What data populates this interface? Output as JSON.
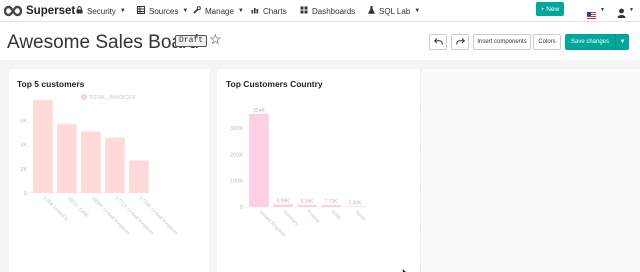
{
  "navbar": {
    "brand": "Superset",
    "menu": [
      {
        "label": "Security",
        "icon": "lock-icon"
      },
      {
        "label": "Sources",
        "icon": "database-icon"
      },
      {
        "label": "Manage",
        "icon": "wrench-icon"
      },
      {
        "label": "Charts",
        "icon": "bar-chart-icon"
      },
      {
        "label": "Dashboards",
        "icon": "dashboard-icon"
      },
      {
        "label": "SQL Lab",
        "icon": "flask-icon"
      }
    ],
    "new_button": "+ New",
    "language_icon": "us-flag-icon",
    "user_icon": "user-icon"
  },
  "header": {
    "title": "Awesome Sales Board",
    "badge": "Draft",
    "favorite_icon": "star-outline-icon",
    "undo_icon": "undo-icon",
    "redo_icon": "redo-icon",
    "insert_components": "Insert components",
    "colors": "Colors",
    "save_changes": "Save changes"
  },
  "colors": {
    "accent": "#00a699",
    "bar_chart1": "#ffdada",
    "bar_chart2": "#ffd0e4"
  },
  "chart_data": [
    {
      "type": "bar",
      "title": "Top 5 customers",
      "legend": [
        "TOTAL_INVOICES"
      ],
      "legend_position": "top",
      "categories": [
        "1784: United K...",
        "18511: EIRE",
        "18086: United Kingdom",
        "17713: United Kingdom",
        "17746: United Kingdom"
      ],
      "values": [
        7700,
        5700,
        5100,
        4600,
        2700
      ],
      "yticks": [
        "0",
        "2K",
        "4K",
        "6K"
      ],
      "ylim": [
        0,
        8200
      ]
    },
    {
      "type": "bar",
      "title": "Top Customers Country",
      "categories": [
        "United Kingdom",
        "Germany",
        "France",
        "EIRE",
        "Spain"
      ],
      "values": [
        354000,
        9990,
        8340,
        7720,
        2450
      ],
      "data_labels": [
        "354K",
        "9.99K",
        "8.34K",
        "7.72K",
        "2.45K"
      ],
      "yticks": [
        "0",
        "100K",
        "200K",
        "300K"
      ],
      "ylim": [
        0,
        380000
      ]
    }
  ]
}
